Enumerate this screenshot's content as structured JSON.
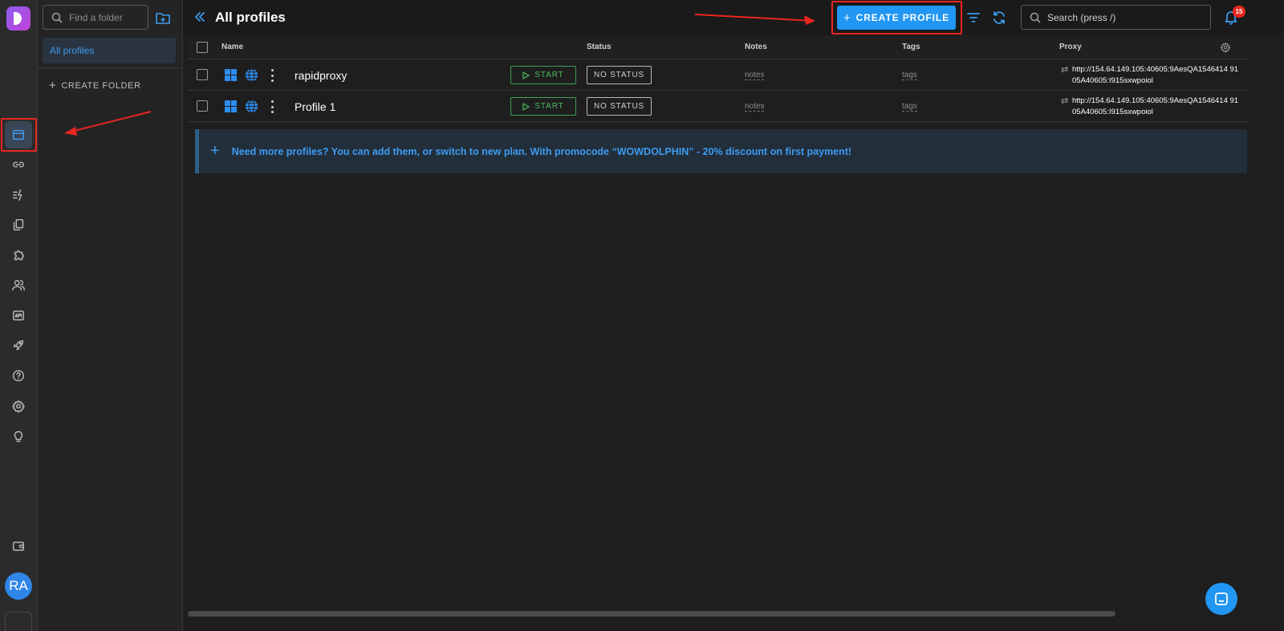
{
  "app": {
    "accent": "#2196f3",
    "highlight": "#e8261f"
  },
  "rail": {
    "items": [
      {
        "name": "profiles-icon",
        "active": true
      },
      {
        "name": "link-icon"
      },
      {
        "name": "automation-icon"
      },
      {
        "name": "copy-icon"
      },
      {
        "name": "puzzle-icon"
      },
      {
        "name": "users-icon"
      },
      {
        "name": "api-icon"
      },
      {
        "name": "rocket-icon"
      },
      {
        "name": "help-icon"
      },
      {
        "name": "gear-icon"
      },
      {
        "name": "lightbulb-icon"
      },
      {
        "name": "wallet-icon"
      }
    ],
    "avatar_initials": "RA"
  },
  "folders": {
    "search_placeholder": "Find a folder",
    "items": [
      {
        "label": "All profiles"
      }
    ],
    "create_label": "CREATE FOLDER"
  },
  "header": {
    "title": "All profiles",
    "create_label": "CREATE PROFILE",
    "search_placeholder": "Search (press /)",
    "notification_count": "15"
  },
  "table": {
    "columns": [
      "Name",
      "Status",
      "Notes",
      "Tags",
      "Proxy"
    ],
    "rows": [
      {
        "name": "rapidproxy",
        "start_label": "START",
        "status": "NO STATUS",
        "notes": "notes",
        "tags": "tags",
        "proxy": "http://154.64.149.105:40605:9AesQA1546414 9105A40605:I915sxwpoiol"
      },
      {
        "name": "Profile 1",
        "start_label": "START",
        "status": "NO STATUS",
        "notes": "notes",
        "tags": "tags",
        "proxy": "http://154.64.149.105:40605:9AesQA1546414 9105A40605:I915sxwpoiol"
      }
    ]
  },
  "banner": {
    "text": "Need more profiles? You can add them, or switch to new plan. With promocode “WOWDOLPHIN” - 20% discount on first payment!"
  }
}
